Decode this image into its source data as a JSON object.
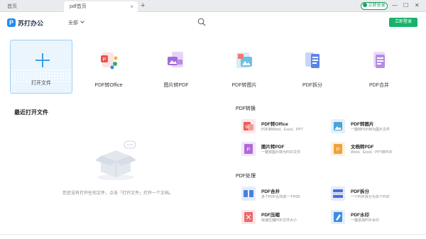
{
  "tabs": {
    "home": "首页",
    "active": "pdf首页",
    "close": "×",
    "add": "+"
  },
  "titlebar": {
    "login": "立即登录",
    "min": "—",
    "max": "☐",
    "close": "✕"
  },
  "header": {
    "logo_text": "苏打办公",
    "logo_mark": "P",
    "filter": "全部",
    "cta": "立即登录"
  },
  "open_card": {
    "label": "打开文件"
  },
  "tools": [
    {
      "label": "PDF转Office",
      "icon": "pdf-to-office-icon"
    },
    {
      "label": "图片转PDF",
      "icon": "image-to-pdf-icon"
    },
    {
      "label": "PDF转图片",
      "icon": "pdf-to-image-icon"
    },
    {
      "label": "PDF拆分",
      "icon": "pdf-split-icon"
    },
    {
      "label": "PDF合并",
      "icon": "pdf-merge-icon"
    }
  ],
  "recent": {
    "title": "最近打开文件",
    "empty": "您还没有打开任何文件，点击「打开文件」打开一个文档。"
  },
  "convert": {
    "title": "PDF转换",
    "items": [
      {
        "title": "PDF转Office",
        "desc": "PDF转Word、Excel、PPT",
        "color": "#e85d5d"
      },
      {
        "title": "PDF转图片",
        "desc": "一键转PDF转为图片文件",
        "color": "#4aa3d8"
      },
      {
        "title": "图片转PDF",
        "desc": "一键将图片转为PDF文件",
        "color": "#b06ad6"
      },
      {
        "title": "文档转PDF",
        "desc": "Word、Excel、PPT转PDF",
        "color": "#f0a23a"
      }
    ]
  },
  "process": {
    "title": "PDF处理",
    "items": [
      {
        "title": "PDF合并",
        "desc": "多个PDF合并成一个PDF",
        "color": "#4a7fe0"
      },
      {
        "title": "PDF拆分",
        "desc": "一个PDF拆分为多个PDF",
        "color": "#4a6fd8"
      },
      {
        "title": "PDF压缩",
        "desc": "快速压缩PDF文件大小",
        "color": "#e86a6a"
      },
      {
        "title": "PDF水印",
        "desc": "一键添加PDF水印",
        "color": "#3d8ee0"
      }
    ]
  }
}
